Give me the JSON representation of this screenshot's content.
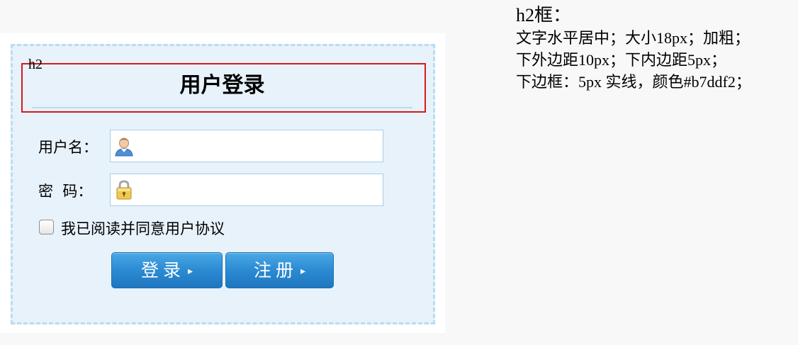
{
  "annotation": {
    "marker_label": "h2",
    "box_color": "#d7191f"
  },
  "login_panel": {
    "title": "用户登录",
    "border_color": "#b7ddf2",
    "background_color": "#e8f2fb",
    "username": {
      "label": "用户名：",
      "value": "",
      "placeholder": "",
      "icon": "user-icon"
    },
    "password": {
      "label": "密  码：",
      "value": "",
      "placeholder": "",
      "icon": "lock-icon"
    },
    "agreement": {
      "checked": false,
      "label": "我已阅读并同意用户协议"
    },
    "buttons": {
      "login_label": "登录",
      "register_label": "注册",
      "arrow": "▸",
      "color": "#2b8bd2"
    }
  },
  "notes": {
    "title": "h2框：",
    "lines": [
      "文字水平居中；大小18px；加粗；",
      "下外边距10px；下内边距5px；",
      "下边框：5px 实线，颜色#b7ddf2；"
    ]
  }
}
